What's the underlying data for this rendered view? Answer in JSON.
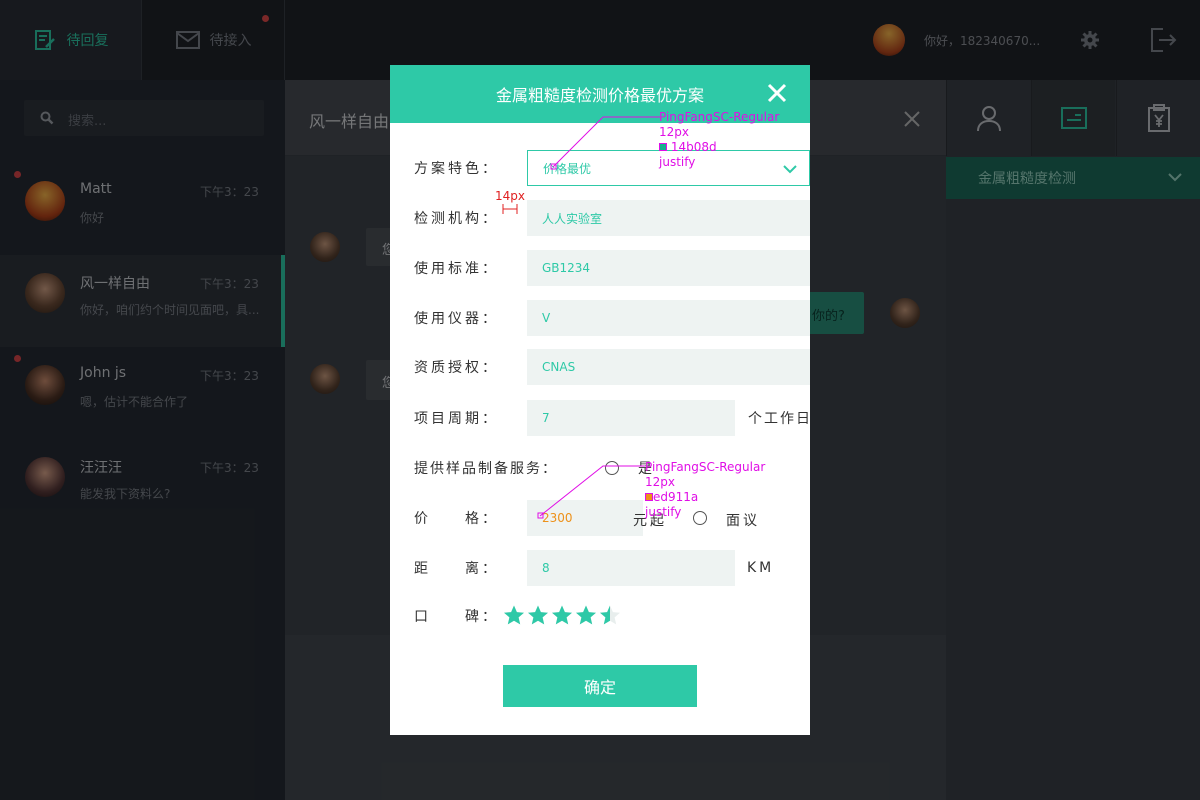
{
  "topbar": {
    "tab_reply": "待回复",
    "tab_accept": "待接入",
    "greeting": "你好，182340670..."
  },
  "sidebar": {
    "search_placeholder": "搜索...",
    "contacts": [
      {
        "name": "Matt",
        "time": "下午3：23",
        "message": "你好",
        "unread": true
      },
      {
        "name": "风一样自由",
        "time": "下午3：23",
        "message": "你好，咱们约个时间见面吧，具...",
        "unread": false
      },
      {
        "name": "John js",
        "time": "下午3：23",
        "message": "嗯，估计不能合作了",
        "unread": true
      },
      {
        "name": "汪汪汪",
        "time": "下午3：23",
        "message": "能发我下资料么?",
        "unread": false
      }
    ]
  },
  "chat": {
    "title": "风一样自由",
    "bubble_1": "您",
    "bubble_2": "你的?",
    "bubble_3": "您"
  },
  "right_panel": {
    "strip_label": "金属粗糙度检测"
  },
  "modal": {
    "title": "金属粗糙度检测价格最优方案",
    "labels": {
      "feature": "方案特色：",
      "agency": "检测机构：",
      "standard": "使用标准：",
      "instrument": "使用仪器：",
      "qualification": "资质授权：",
      "period": "项目周期：",
      "sample_service": "提供样品制备服务：",
      "price": "价　　格：",
      "distance": "距　　离：",
      "reputation": "口　　碑："
    },
    "values": {
      "feature": "价格最优",
      "agency": "人人实验室",
      "standard": "GB1234",
      "instrument": "V",
      "qualification": "CNAS",
      "period": "7",
      "price": "2300",
      "distance": "8"
    },
    "units": {
      "period": "个工作日",
      "price": "元起",
      "negotiable": "面议",
      "distance": "KM"
    },
    "sample_option_yes": "是",
    "rating": 4.5,
    "rating_max": 5,
    "confirm": "确定"
  },
  "annotations": {
    "a1_font": "PingFangSC-Regular",
    "a1_size": "12px",
    "a1_color": "14b08d",
    "a1_align": "justify",
    "a2_font": "PingFangSC-Regular",
    "a2_size": "12px",
    "a2_color": "ed911a",
    "a2_align": "justify",
    "spacing": "14px"
  },
  "colors": {
    "accent": "#2ec9a7",
    "price": "#ed911a",
    "annotation": "#e00ee6"
  }
}
